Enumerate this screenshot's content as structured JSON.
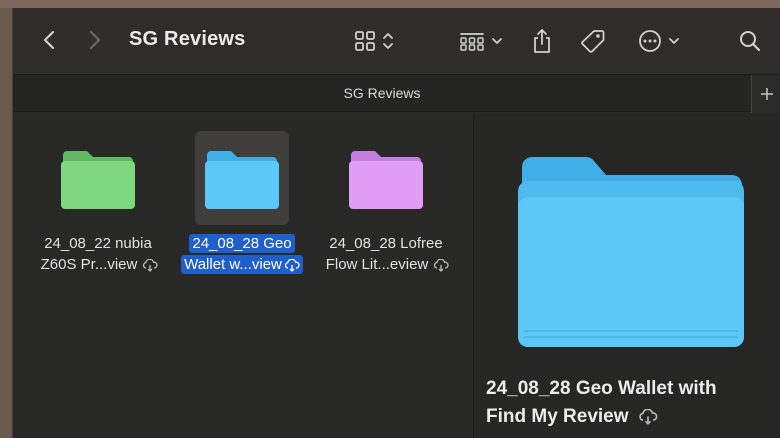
{
  "window": {
    "title": "SG Reviews",
    "tab_label": "SG Reviews"
  },
  "toolbar": {
    "back_icon": "chevron-left-icon",
    "forward_icon": "chevron-right-icon",
    "view_icon": "grid-view-icon",
    "group_icon": "group-by-icon",
    "share_icon": "share-icon",
    "tag_icon": "tag-icon",
    "more_icon": "ellipsis-icon",
    "search_icon": "search-icon"
  },
  "files": [
    {
      "line1": "24_08_22 nubia",
      "line2": "Z60S Pr...view",
      "color": "#7dd87f",
      "tab": "#5fb961",
      "selected": false
    },
    {
      "line1": "24_08_28 Geo",
      "line2": "Wallet w...view",
      "color": "#5cc8f7",
      "tab": "#3faee6",
      "selected": true
    },
    {
      "line1": "24_08_28 Lofree",
      "line2": "Flow Lit...eview",
      "color": "#e19cf5",
      "tab": "#c47fde",
      "selected": false
    }
  ],
  "preview": {
    "title_line1": "24_08_28 Geo Wallet with",
    "title_line2": "Find My Review",
    "folder_color": "#5cc8f7"
  },
  "colors": {
    "selection": "#1f5fc9",
    "background": "#2b2a29"
  }
}
